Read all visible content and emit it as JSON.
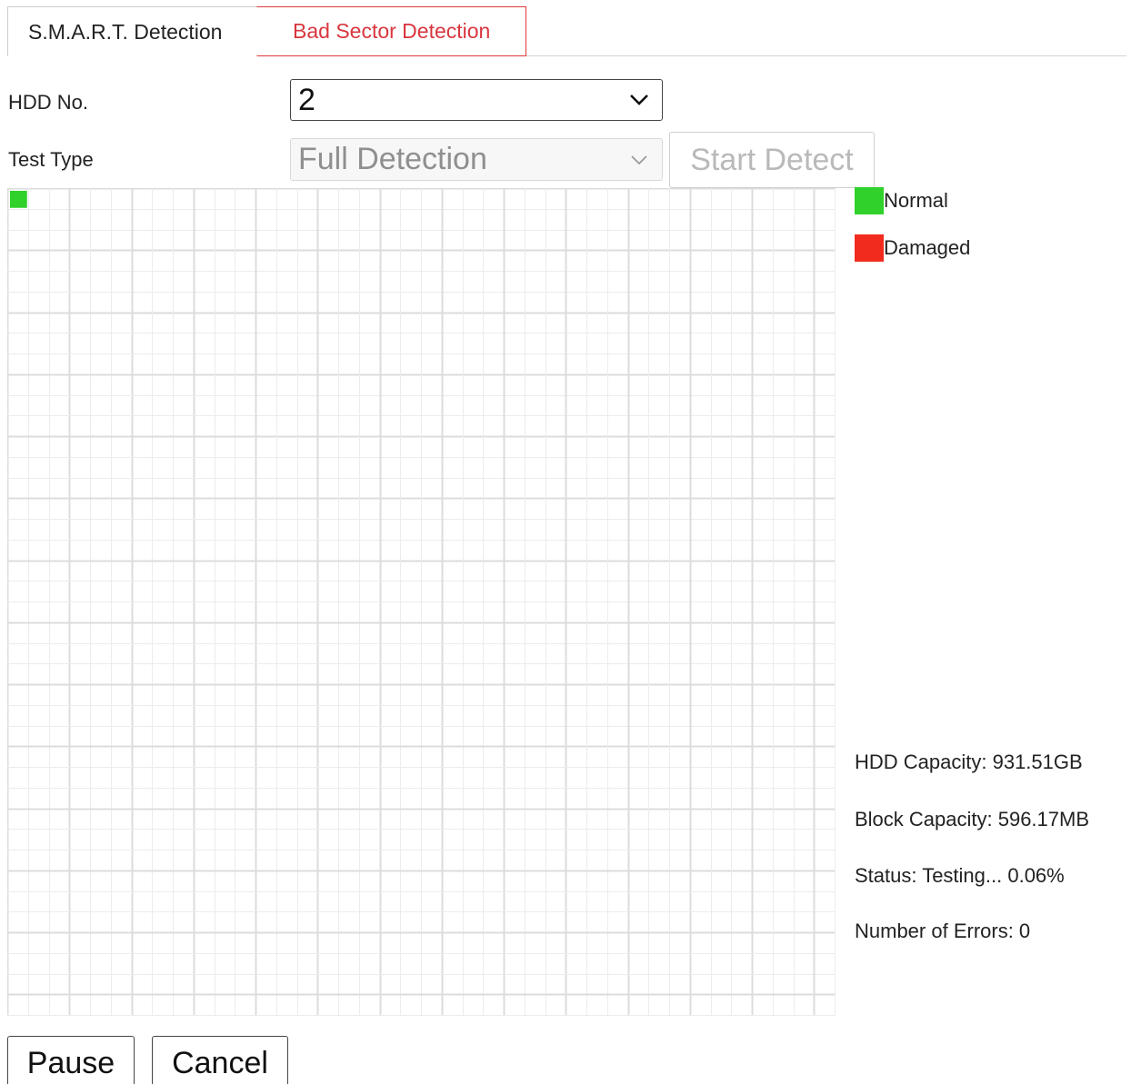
{
  "tabs": [
    {
      "label": "S.M.A.R.T. Detection",
      "active": false
    },
    {
      "label": "Bad Sector Detection",
      "active": true
    }
  ],
  "form": {
    "hdd_no_label": "HDD No.",
    "hdd_no_value": "2",
    "test_type_label": "Test Type",
    "test_type_value": "Full Detection",
    "start_detect_label": "Start Detect"
  },
  "block_grid": {
    "columns": 40,
    "rows": 40,
    "tested_blocks": 1,
    "damaged_blocks": 0
  },
  "legend": [
    {
      "label": "Normal",
      "color": "#2fd12a"
    },
    {
      "label": "Damaged",
      "color": "#f12b1d"
    }
  ],
  "info": {
    "hdd_capacity": "HDD Capacity: 931.51GB",
    "block_capacity": "Block Capacity: 596.17MB",
    "status": "Status: Testing... 0.06%",
    "errors": "Number of Errors: 0"
  },
  "buttons": {
    "pause": "Pause",
    "cancel": "Cancel"
  },
  "colors": {
    "accent_red": "#d9363e",
    "grid_line": "#e3e3e3"
  }
}
